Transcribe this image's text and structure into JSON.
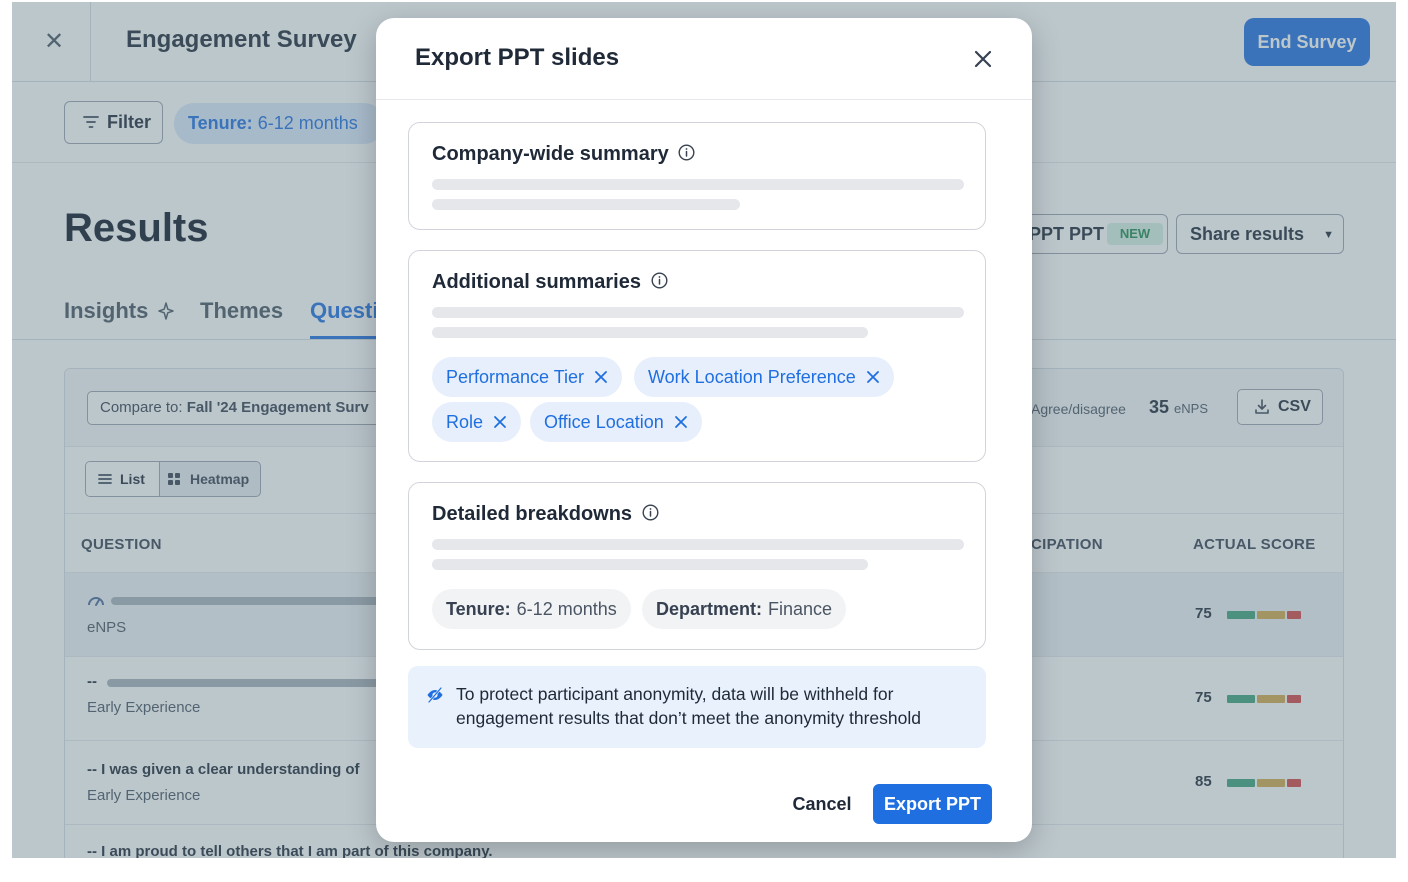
{
  "header": {
    "survey_title": "Engagement Survey",
    "end_survey": "End Survey"
  },
  "filterbar": {
    "filter_label": "Filter",
    "tenure_key": "Tenure:",
    "tenure_value": "6-12 months"
  },
  "results": {
    "title": "Results",
    "ppt_button": "PPT PPT",
    "new_badge": "NEW",
    "share_button": "Share results"
  },
  "tabs": [
    {
      "label": "Insights"
    },
    {
      "label": "Themes"
    },
    {
      "label": "Questi"
    }
  ],
  "panel": {
    "compare_prefix": "Compare to:",
    "compare_value": "Fall '24 Engagement Surv",
    "agree_label": "Agree/disagree",
    "enps_value": "35",
    "enps_unit": "eNPS",
    "csv_label": "CSV",
    "view_list": "List",
    "view_heatmap": "Heatmap",
    "columns": {
      "question": "QUESTION",
      "participation": "CIPATION",
      "actual_score": "ACTUAL SCORE"
    },
    "rows": [
      {
        "main": "",
        "sub": "eNPS",
        "score": "75"
      },
      {
        "main": "--",
        "sub": "Early Experience",
        "score": "75"
      },
      {
        "main": "-- I was given a clear understanding of",
        "sub": "Early Experience",
        "score": "85"
      },
      {
        "main": "-- I am proud to tell others that I am part of this company.",
        "sub": "",
        "score": ""
      }
    ],
    "score_colors": {
      "positive": "#3fa37a",
      "neutral": "#d2a84a",
      "negative": "#d64545"
    }
  },
  "modal": {
    "title": "Export PPT slides",
    "company_summary": "Company-wide summary",
    "additional_summaries": "Additional summaries",
    "additional_chips": [
      "Performance Tier",
      "Work Location Preference",
      "Role",
      "Office Location"
    ],
    "detailed_breakdowns": "Detailed breakdowns",
    "breakdown_chips": [
      {
        "key": "Tenure:",
        "value": "6-12 months"
      },
      {
        "key": "Department:",
        "value": "Finance"
      }
    ],
    "notice": "To protect participant anonymity, data will be withheld for engagement results that don’t meet the anonymity threshold",
    "cancel": "Cancel",
    "export": "Export PPT"
  },
  "colors": {
    "accent": "#1f6fe0",
    "overlay": "#607a86"
  }
}
